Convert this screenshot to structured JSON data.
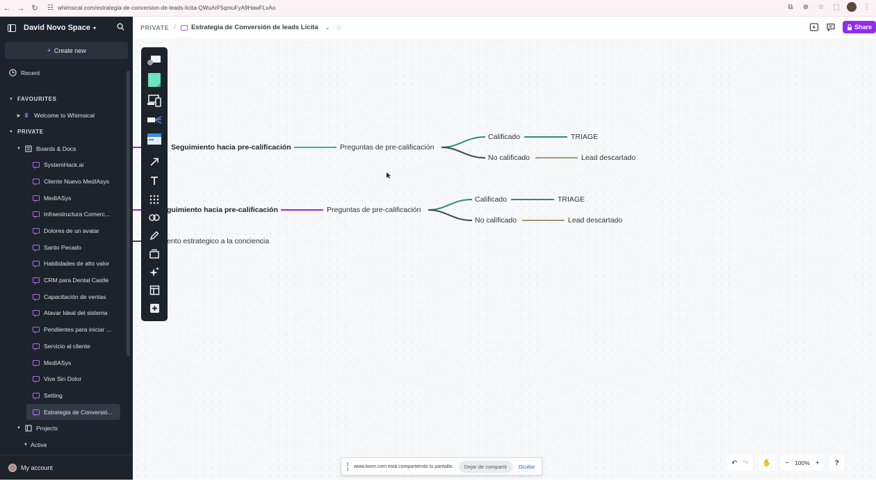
{
  "browser": {
    "url": "whimsical.com/estrategia-de-conversion-de-leads-licita-QWuArF5qmuFyA9HawFLvAo"
  },
  "sidebar": {
    "space_name": "David Novo Space",
    "create_label": "Create new",
    "recent_label": "Recent",
    "favourites_label": "FAVOURITES",
    "favourite_item": "Welcome to Whimsical",
    "private_label": "PRIVATE",
    "boards_label": "Boards & Docs",
    "docs": [
      "SystemHack.ai",
      "Cliente Nuevo MedIAsys",
      "MedIASys",
      "Infraestructura Comerc...",
      "Dolores de un avatar",
      "Santo Pecado",
      "Habilidades de alto valor",
      "CRM para Dental Castle",
      "Capacitación de ventas",
      "Atavar Ideal del sistema",
      "Pendientes para iniciar ...",
      "Servicio al cliente",
      "MedIASys",
      "Vive Sin Dolor",
      "Setting",
      "Estrategia de Conversió..."
    ],
    "projects_label": "Projects",
    "active_label": "Active",
    "account_label": "My account"
  },
  "topbar": {
    "private_label": "PRIVATE",
    "doc_title": "Estrategia de Conversión de leads Licita",
    "share_label": "Share"
  },
  "mindmap": {
    "branch1": {
      "root": "Seguimiento hacia pre-calificación",
      "child": "Preguntas de pre-calificación",
      "qualified": "Calificado",
      "qualified_next": "TRIAGE",
      "not_qualified": "No calificado",
      "not_qualified_next": "Lead descartado"
    },
    "branch2": {
      "root": "guimiento hacia pre-calificación",
      "child": "Preguntas de pre-calificación",
      "qualified": "Calificado",
      "qualified_next": "TRIAGE",
      "not_qualified": "No calificado",
      "not_qualified_next": "Lead descartado"
    },
    "branch3": {
      "root": "ento estrategico a la conciencia"
    },
    "colors": {
      "teal": "#2bb59a",
      "purple": "#9b27d6",
      "dark": "#3b4652",
      "green": "#2e8b74",
      "olive": "#a09a78"
    }
  },
  "loom": {
    "message": "www.loom.com está compartiendo tu pantalla.",
    "stop_label": "Dejar de compartir",
    "hide_label": "Ocultar"
  },
  "zoom": {
    "level": "100%"
  }
}
